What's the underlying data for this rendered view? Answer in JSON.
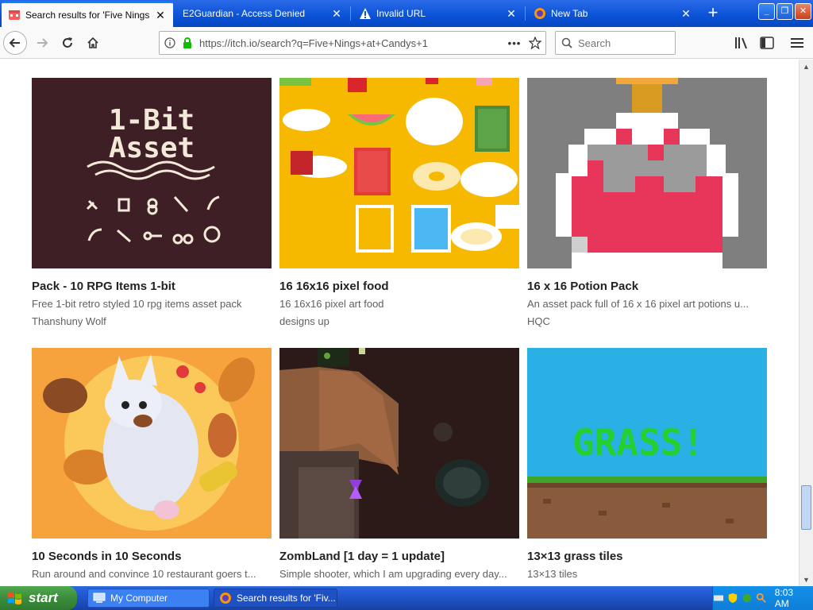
{
  "browser": {
    "tabs": [
      {
        "label": "Search results for 'Five Nings at C",
        "active": true
      },
      {
        "label": "E2Guardian - Access Denied",
        "active": false
      },
      {
        "label": "Invalid URL",
        "active": false
      },
      {
        "label": "New Tab",
        "active": false
      }
    ],
    "new_tab_label": "+",
    "window_buttons": {
      "minimize": "_",
      "restore": "❐",
      "close": "✕"
    },
    "url": "https://itch.io/search?q=Five+Nings+at+Candys+1",
    "url_more": "•••",
    "search_placeholder": "Search"
  },
  "results": [
    {
      "title": "Pack - 10 RPG Items 1-bit",
      "description": "Free 1-bit retro styled 10 rpg items asset pack",
      "author": "Thanshuny Wolf",
      "thumb_text": [
        "1-Bit",
        "Asset"
      ]
    },
    {
      "title": "16 16x16 pixel food",
      "description": "16 16x16 pixel art food",
      "author": "designs up"
    },
    {
      "title": "16 x 16 Potion Pack",
      "description": "An asset pack full of 16 x 16 pixel art potions u...",
      "author": "HQC"
    },
    {
      "title": "10 Seconds in 10 Seconds",
      "description": "Run around and convince 10 restaurant goers t...",
      "author": ""
    },
    {
      "title": "ZombLand [1 day = 1 update]",
      "description": "Simple shooter, which I am upgrading every day...",
      "author": ""
    },
    {
      "title": "13×13 grass tiles",
      "description": "13×13 tiles",
      "author": "",
      "thumb_text": [
        "GRASS!"
      ]
    }
  ],
  "taskbar": {
    "start_label": "start",
    "tasks": [
      {
        "label": "My Computer"
      },
      {
        "label": "Search results for 'Fiv..."
      }
    ],
    "clock": "8:03 AM"
  },
  "colors": {
    "xp_blue": "#0a52d6",
    "start_green": "#3c8c3c",
    "accent": "#0a84ff"
  }
}
